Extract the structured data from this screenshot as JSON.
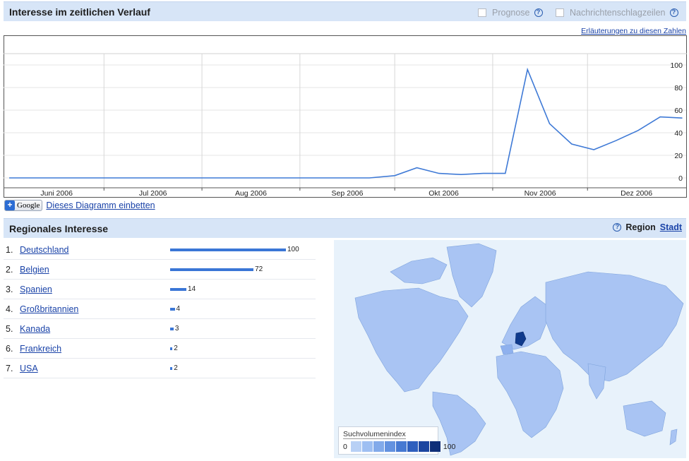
{
  "time_section": {
    "title": "Interesse im zeitlichen Verlauf",
    "prognose_label": "Prognose",
    "news_label": "Nachrichtenschlagzeilen",
    "help_glyph": "?",
    "explain_link": "Erläuterungen zu diesen Zahlen"
  },
  "embed": {
    "button_plus": "+",
    "button_logo": "Google",
    "link": "Dieses Diagramm einbetten"
  },
  "region_section": {
    "title": "Regionales Interesse",
    "help_glyph": "?",
    "region_label": "Region",
    "city_link": "Stadt",
    "rows": [
      {
        "rank": "1.",
        "name": "Deutschland",
        "value": 100
      },
      {
        "rank": "2.",
        "name": "Belgien",
        "value": 72
      },
      {
        "rank": "3.",
        "name": "Spanien",
        "value": 14
      },
      {
        "rank": "4.",
        "name": "Großbritannien",
        "value": 4
      },
      {
        "rank": "5.",
        "name": "Kanada",
        "value": 3
      },
      {
        "rank": "6.",
        "name": "Frankreich",
        "value": 2
      },
      {
        "rank": "7.",
        "name": "USA",
        "value": 2
      }
    ]
  },
  "map": {
    "legend_title": "Suchvolumenindex",
    "legend_min": "0",
    "legend_max": "100",
    "legend_colors": [
      "#b8d0f5",
      "#9ebff2",
      "#82aaea",
      "#6392e0",
      "#4679d2",
      "#2e5fbe",
      "#1c46a0",
      "#0f2f78"
    ],
    "land_color": "#a9c4f3",
    "highlight_color": "#0f3a8c",
    "ocean_color": "#e8f2fb"
  },
  "chart_data": {
    "type": "line",
    "x_months": [
      "Juni 2006",
      "Jul 2006",
      "Aug 2006",
      "Sep 2006",
      "Okt 2006",
      "Nov 2006",
      "Dez 2006"
    ],
    "x": [
      "2006-06-01",
      "2006-06-15",
      "2006-07-01",
      "2006-07-15",
      "2006-08-01",
      "2006-08-15",
      "2006-09-01",
      "2006-09-15",
      "2006-09-23",
      "2006-10-01",
      "2006-10-08",
      "2006-10-15",
      "2006-10-22",
      "2006-10-29",
      "2006-11-05",
      "2006-11-12",
      "2006-11-19",
      "2006-11-26",
      "2006-12-03",
      "2006-12-10",
      "2006-12-17",
      "2006-12-24",
      "2006-12-31"
    ],
    "series": [
      {
        "values": [
          0,
          0,
          0,
          0,
          0,
          0,
          0,
          0,
          0,
          2,
          9,
          4,
          3,
          4,
          4,
          96,
          48,
          30,
          25,
          33,
          42,
          54,
          53
        ]
      }
    ],
    "yticks": [
      0,
      20,
      40,
      60,
      80,
      100
    ],
    "ylim": [
      -5,
      110
    ],
    "grid": true,
    "line_color": "#3f7ad6"
  }
}
